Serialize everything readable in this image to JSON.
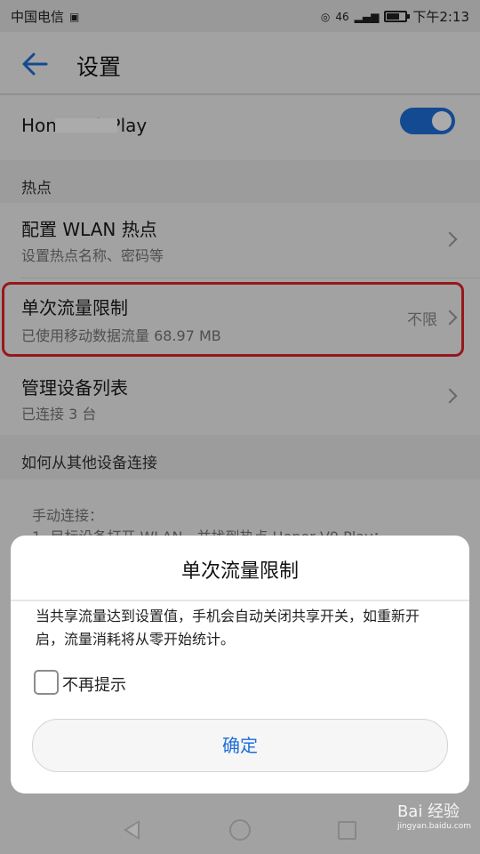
{
  "status_bar": {
    "carrier": "中国电信",
    "network": "46",
    "time": "下午2:13"
  },
  "header": {
    "title": "设置"
  },
  "hotspot_name": "Honor V9 Play",
  "sections": {
    "hotspot": "热点",
    "how_to_connect": "如何从其他设备连接"
  },
  "rows": {
    "config": {
      "title": "配置 WLAN 热点",
      "subtitle": "设置热点名称、密码等"
    },
    "data_limit": {
      "title": "单次流量限制",
      "subtitle": "已使用移动数据流量 68.97 MB",
      "value": "不限"
    },
    "devices": {
      "title": "管理设备列表",
      "subtitle": "已连接 3 台"
    }
  },
  "help": {
    "line1": "手动连接：",
    "line2": "1. 目标设备打开 WLAN，并找到热点 Honor V9 Play；"
  },
  "dialog": {
    "title": "单次流量限制",
    "message": "当共享流量达到设置值，手机会自动关闭共享开关，如重新开启，流量消耗将从零开始统计。",
    "checkbox_label": "不再提示",
    "confirm": "确定"
  },
  "watermark": {
    "brand": "Bai 经验",
    "url": "jingyan.baidu.com"
  },
  "colors": {
    "accent": "#1f6fd8",
    "highlight": "#e0242a"
  },
  "icons": [
    "back-arrow-icon",
    "chevron-right-icon",
    "battery-icon",
    "signal-icon",
    "wifi-hotspot-icon",
    "nav-back-icon",
    "nav-home-icon",
    "nav-recent-icon"
  ]
}
